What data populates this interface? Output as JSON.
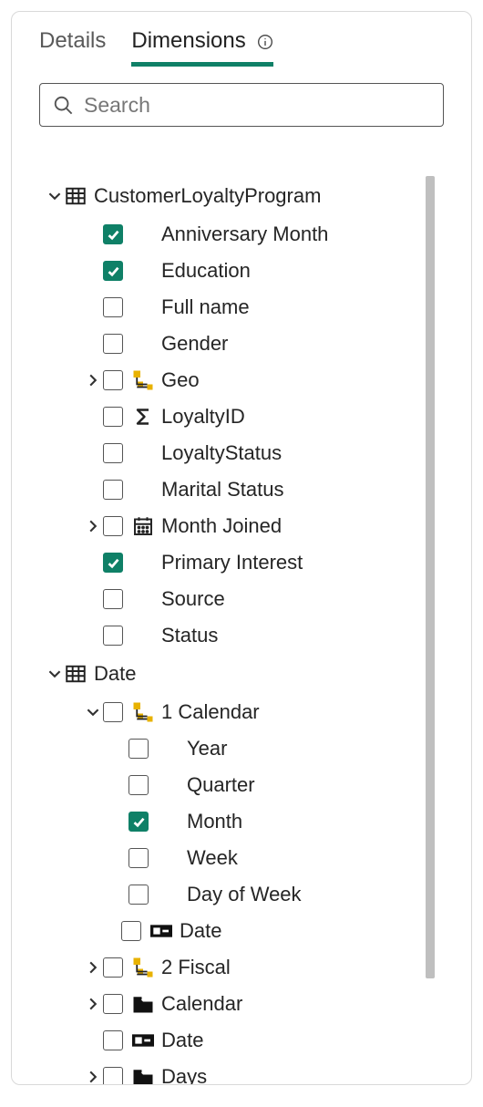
{
  "tabs": {
    "details": "Details",
    "dimensions": "Dimensions"
  },
  "search": {
    "placeholder": "Search",
    "value": ""
  },
  "tree": {
    "n0": "CustomerLoyaltyProgram",
    "n0_0": "Anniversary Month",
    "n0_1": "Education",
    "n0_2": "Full name",
    "n0_3": "Gender",
    "n0_4": "Geo",
    "n0_5": "LoyaltyID",
    "n0_6": "LoyaltyStatus",
    "n0_7": "Marital Status",
    "n0_8": "Month Joined",
    "n0_9": "Primary Interest",
    "n0_10": "Source",
    "n0_11": "Status",
    "n1": "Date",
    "n1_0": "1 Calendar",
    "n1_0_0": "Year",
    "n1_0_1": "Quarter",
    "n1_0_2": "Month",
    "n1_0_3": "Week",
    "n1_0_4": "Day of Week",
    "n1_0_5": "Date",
    "n1_1": "2 Fiscal",
    "n1_2": "Calendar",
    "n1_3": "Date",
    "n1_4": "Days"
  },
  "colors": {
    "accent": "#0f8067"
  }
}
